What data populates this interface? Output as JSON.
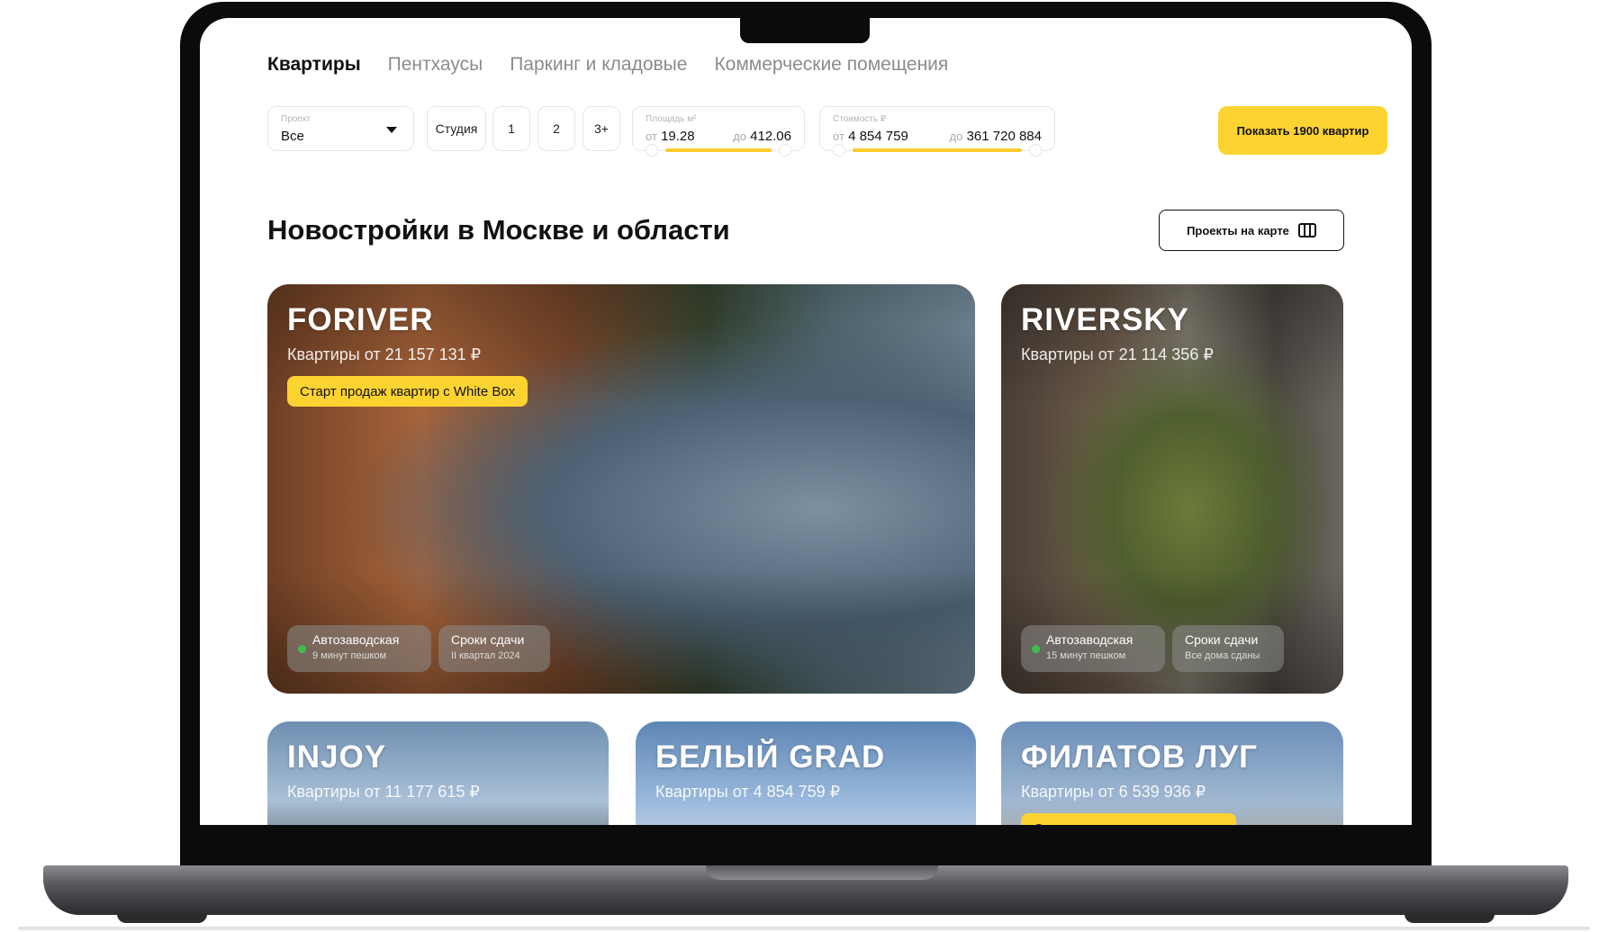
{
  "tabs": [
    {
      "label": "Квартиры",
      "active": true
    },
    {
      "label": "Пентхаусы",
      "active": false
    },
    {
      "label": "Паркинг и кладовые",
      "active": false
    },
    {
      "label": "Коммерческие помещения",
      "active": false
    }
  ],
  "filters": {
    "project": {
      "label": "Проект",
      "value": "Все"
    },
    "rooms": [
      "Студия",
      "1",
      "2",
      "3+"
    ],
    "area": {
      "label": "Площадь м²",
      "from_label": "от",
      "from": "19.28",
      "to_label": "до",
      "to": "412.06"
    },
    "price": {
      "label": "Стоимость ₽",
      "from_label": "от",
      "from": "4 854 759",
      "to_label": "до",
      "to": "361 720 884"
    },
    "show_button": "Показать 1900 квартир"
  },
  "section": {
    "title": "Новостройки в Москве и области",
    "map_button": "Проекты на карте"
  },
  "cards": [
    {
      "title": "FORIVER",
      "price": "Квартиры от 21 157 131 ₽",
      "promo": "Старт продаж квартир с White Box",
      "metro": "Автозаводская",
      "metro_walk": "9 минут пешком",
      "deadline_label": "Сроки сдачи",
      "deadline": "II квартал 2024"
    },
    {
      "title": "RIVERSKY",
      "price": "Квартиры от 21 114 356 ₽",
      "metro": "Автозаводская",
      "metro_walk": "15 минут пешком",
      "deadline_label": "Сроки сдачи",
      "deadline": "Все дома сданы"
    },
    {
      "title": "INJOY",
      "price": "Квартиры от 11 177 615 ₽"
    },
    {
      "title": "БЕЛЫЙ GRAD",
      "price": "Квартиры от 4 854 759 ₽"
    },
    {
      "title": "ФИЛАТОВ ЛУГ",
      "price": "Квартиры от 6 539 936 ₽",
      "promo": "Старт продаж новых корпусов"
    }
  ],
  "colors": {
    "accent": "#fdd331",
    "metro": "#3cbf4e"
  }
}
